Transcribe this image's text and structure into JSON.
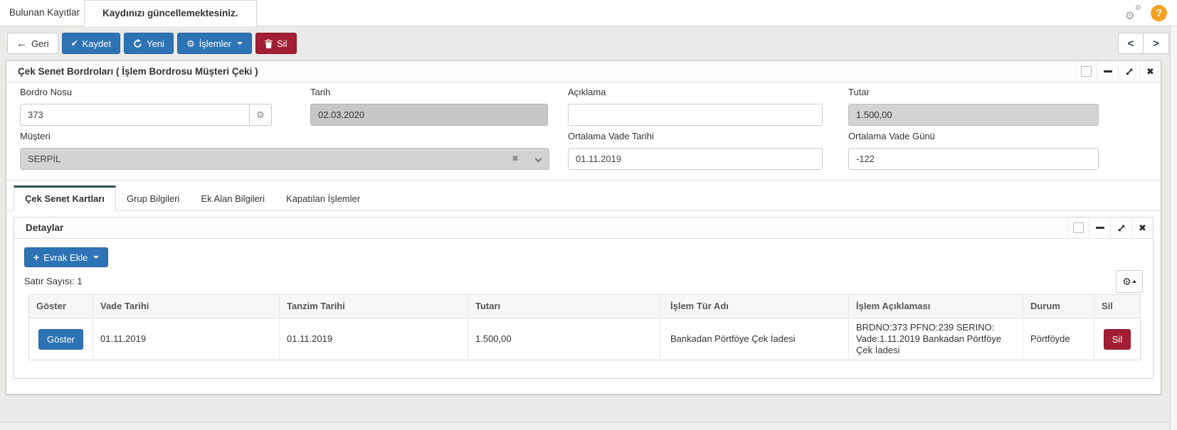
{
  "colors": {
    "primary": "#2e74b5",
    "danger": "#a21e35",
    "help_orange": "#f7a120",
    "tab_accent": "#33525b"
  },
  "icons": {
    "back": "←",
    "check": "✔",
    "gear": "⚙",
    "close": "✖",
    "clear": "✖",
    "plus": "+",
    "prev": "<",
    "next": ">",
    "help": "?"
  },
  "header": {
    "tab_inactive": "Bulunan Kayıtlar",
    "tab_active": "Kaydınızı güncellemektesiniz."
  },
  "toolbar": {
    "back": "Geri",
    "save": "Kaydet",
    "new": "Yeni",
    "actions": "İşlemler",
    "delete": "Sil"
  },
  "panel": {
    "title": "Çek Senet Bordroları ( İşlem Bordrosu Müşteri Çeki )",
    "fields": {
      "bordro_nosu": {
        "label": "Bordro Nosu",
        "value": "373"
      },
      "tarih": {
        "label": "Tarih",
        "value": "02.03.2020"
      },
      "aciklama": {
        "label": "Açıklama",
        "value": ""
      },
      "tutar": {
        "label": "Tutar",
        "value": "1.500,00"
      },
      "musteri": {
        "label": "Müşteri",
        "value": "SERPİL"
      },
      "ortalama_vade_tarihi": {
        "label": "Ortalama Vade Tarihi",
        "value": "01.11.2019"
      },
      "ortalama_vade_gunu": {
        "label": "Ortalama Vade Günü",
        "value": "-122"
      }
    }
  },
  "tabs": {
    "items": [
      {
        "label": "Çek Senet Kartları"
      },
      {
        "label": "Grup Bilgileri"
      },
      {
        "label": "Ek Alan Bilgileri"
      },
      {
        "label": "Kapatılan İşlemler"
      }
    ]
  },
  "detaylar": {
    "title": "Detaylar",
    "add_button": "Evrak Ekle",
    "row_count": "Satır Sayısı: 1",
    "table": {
      "headers": [
        "Göster",
        "Vade Tarihi",
        "Tanzim Tarihi",
        "Tutarı",
        "İşlem Tür Adı",
        "İşlem Açıklaması",
        "Durum",
        "Sil"
      ],
      "row": {
        "goster": "Göster",
        "vade_tarihi": "01.11.2019",
        "tanzim_tarihi": "01.11.2019",
        "tutari": "1.500,00",
        "islem_tur_adi": "Bankadan Pörtföye Çek İadesi",
        "islem_aciklamasi": "BRDNO:373 PFNO:239 SERINO: Vade:1.11.2019 Bankadan Pörtföye Çek İadesi",
        "durum": "Pörtföyde",
        "sil": "Sil"
      }
    }
  }
}
